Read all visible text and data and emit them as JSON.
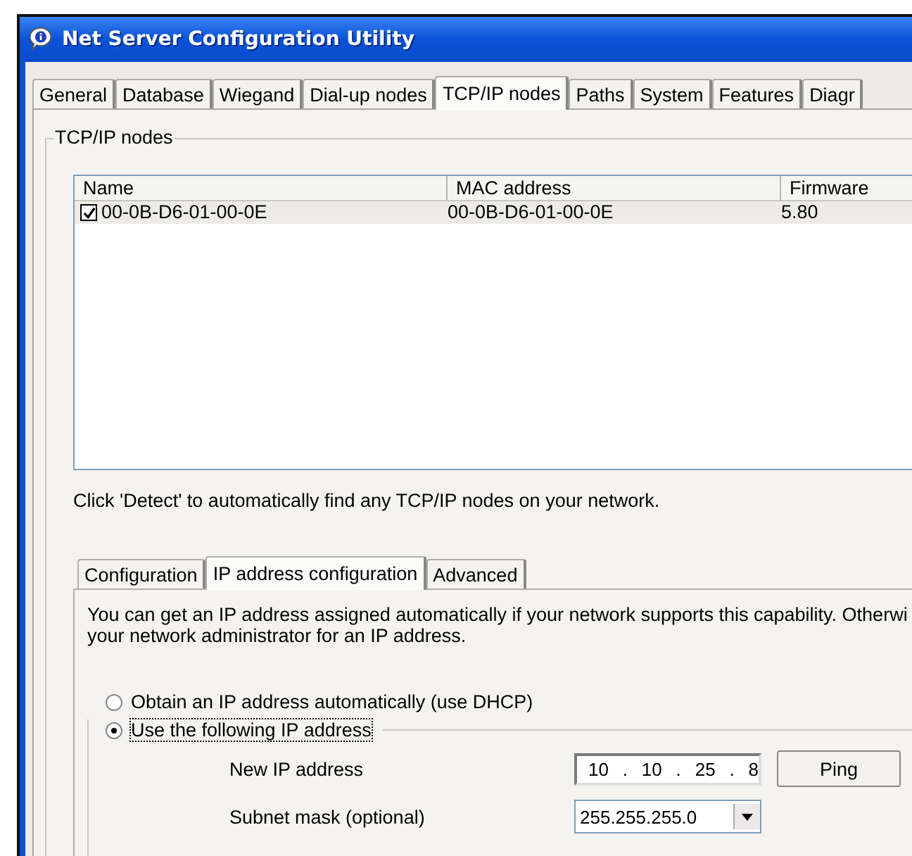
{
  "window": {
    "title": "Net Server Configuration Utility"
  },
  "tabs": [
    {
      "label": "General",
      "selected": false
    },
    {
      "label": "Database",
      "selected": false
    },
    {
      "label": "Wiegand",
      "selected": false
    },
    {
      "label": "Dial-up nodes",
      "selected": false
    },
    {
      "label": "TCP/IP nodes",
      "selected": true
    },
    {
      "label": "Paths",
      "selected": false
    },
    {
      "label": "System",
      "selected": false
    },
    {
      "label": "Features",
      "selected": false
    },
    {
      "label": "Diagr",
      "selected": false
    }
  ],
  "group": {
    "title": "TCP/IP nodes"
  },
  "table": {
    "columns": [
      "Name",
      "MAC address",
      "Firmware"
    ],
    "rows": [
      {
        "checked": true,
        "cells": [
          "00-0B-D6-01-00-0E",
          "00-0B-D6-01-00-0E",
          "5.80"
        ]
      }
    ]
  },
  "hint": "Click 'Detect' to automatically find any TCP/IP nodes on your network.",
  "subtabs": [
    {
      "label": "Configuration",
      "selected": false
    },
    {
      "label": "IP address configuration",
      "selected": true
    },
    {
      "label": "Advanced",
      "selected": false
    }
  ],
  "description": [
    "You can get an IP address assigned automatically if your network supports this capability. Otherwi",
    "your network administrator for an IP address."
  ],
  "radios": [
    {
      "label": "Obtain an IP address automatically (use DHCP)",
      "selected": false
    },
    {
      "label": "Use the following IP address",
      "selected": true
    }
  ],
  "ip": {
    "label": "New IP address",
    "octets": [
      "10",
      "10",
      "25",
      "8"
    ],
    "separator": "."
  },
  "ping_button": "Ping",
  "subnet": {
    "label": "Subnet mask (optional)",
    "value": "255.255.255.0"
  }
}
